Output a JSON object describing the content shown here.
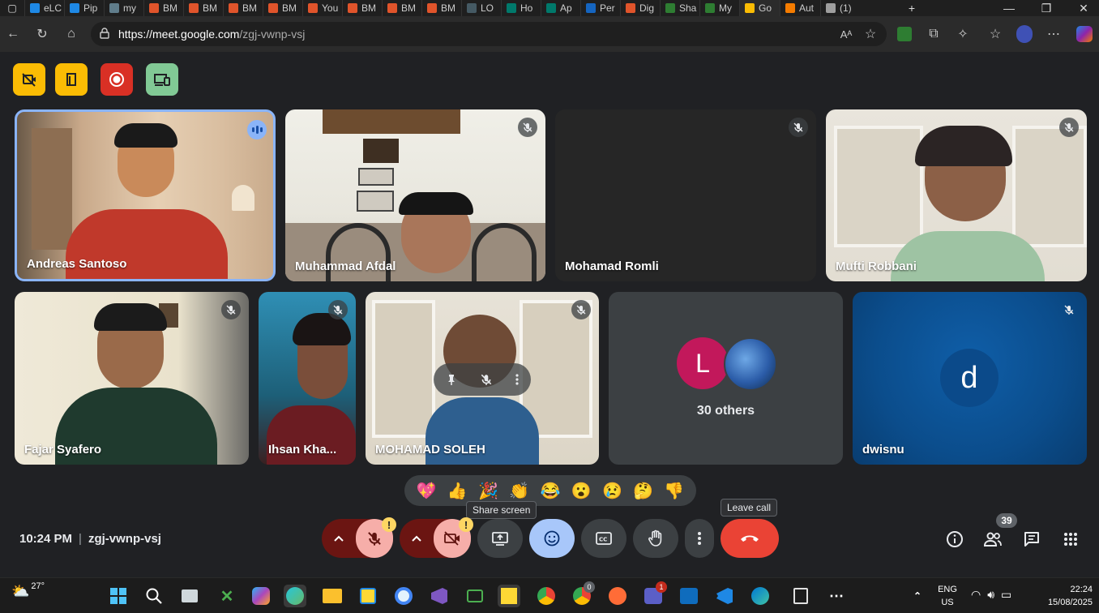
{
  "browser": {
    "tabs": [
      {
        "label": "eLC",
        "color": "#1e88e5"
      },
      {
        "label": "Pip",
        "color": "#1e88e5"
      },
      {
        "label": "my",
        "color": "#607d8b"
      },
      {
        "label": "BM",
        "color": "#e0542b"
      },
      {
        "label": "BM",
        "color": "#e0542b"
      },
      {
        "label": "BM",
        "color": "#e0542b"
      },
      {
        "label": "BM",
        "color": "#e0542b"
      },
      {
        "label": "You",
        "color": "#e0542b"
      },
      {
        "label": "BM",
        "color": "#e0542b"
      },
      {
        "label": "BM",
        "color": "#e0542b"
      },
      {
        "label": "BM",
        "color": "#e0542b"
      },
      {
        "label": "LO",
        "color": "#455a64"
      },
      {
        "label": "Ho",
        "color": "#00796b"
      },
      {
        "label": "Ap",
        "color": "#00796b"
      },
      {
        "label": "Per",
        "color": "#1565c0"
      },
      {
        "label": "Dig",
        "color": "#e0542b"
      },
      {
        "label": "Sha",
        "color": "#2e7d32"
      },
      {
        "label": "My",
        "color": "#2e7d32"
      },
      {
        "label": "Go",
        "color": "#fbbc04"
      },
      {
        "label": "Aut",
        "color": "#f57c00"
      },
      {
        "label": "(1)",
        "color": "#9e9e9e"
      }
    ],
    "url_host": "https://meet.google.com",
    "url_path": "/zgj-vwnp-vsj"
  },
  "participants": [
    {
      "name": "Andreas Santoso",
      "state": "speaking"
    },
    {
      "name": "Muhammad Afdal",
      "state": "muted"
    },
    {
      "name": "Mohamad Romli",
      "state": "muted"
    },
    {
      "name": "Mufti Robbani",
      "state": "muted"
    },
    {
      "name": "Fajar Syafero",
      "state": "muted"
    },
    {
      "name": "Ihsan Kha...",
      "state": "muted"
    },
    {
      "name": "MOHAMAD SOLEH",
      "state": "muted"
    },
    {
      "name": "dwisnu",
      "state": "muted",
      "avatar_letter": "d"
    }
  ],
  "others": {
    "label": "30 others",
    "avatar_letter": "L"
  },
  "reactions": [
    "💖",
    "👍",
    "🎉",
    "👏",
    "😂",
    "😮",
    "😢",
    "🤔",
    "👎"
  ],
  "tooltips": {
    "share": "Share screen",
    "leave": "Leave call"
  },
  "meeting": {
    "time": "10:24 PM",
    "separator": "|",
    "code": "zgj-vwnp-vsj"
  },
  "people_count": "39",
  "taskbar": {
    "weather": "27°",
    "lang_top": "ENG",
    "lang_bottom": "US",
    "time": "22:24",
    "date": "15/08/2025",
    "chrome_badge": "0",
    "teams_badge": "1"
  },
  "colors": {
    "leave": "#ea4335",
    "accent": "#8ab4f8",
    "dwisnu_bg": "#0b4d8c",
    "l_avatar": "#c2185b"
  }
}
